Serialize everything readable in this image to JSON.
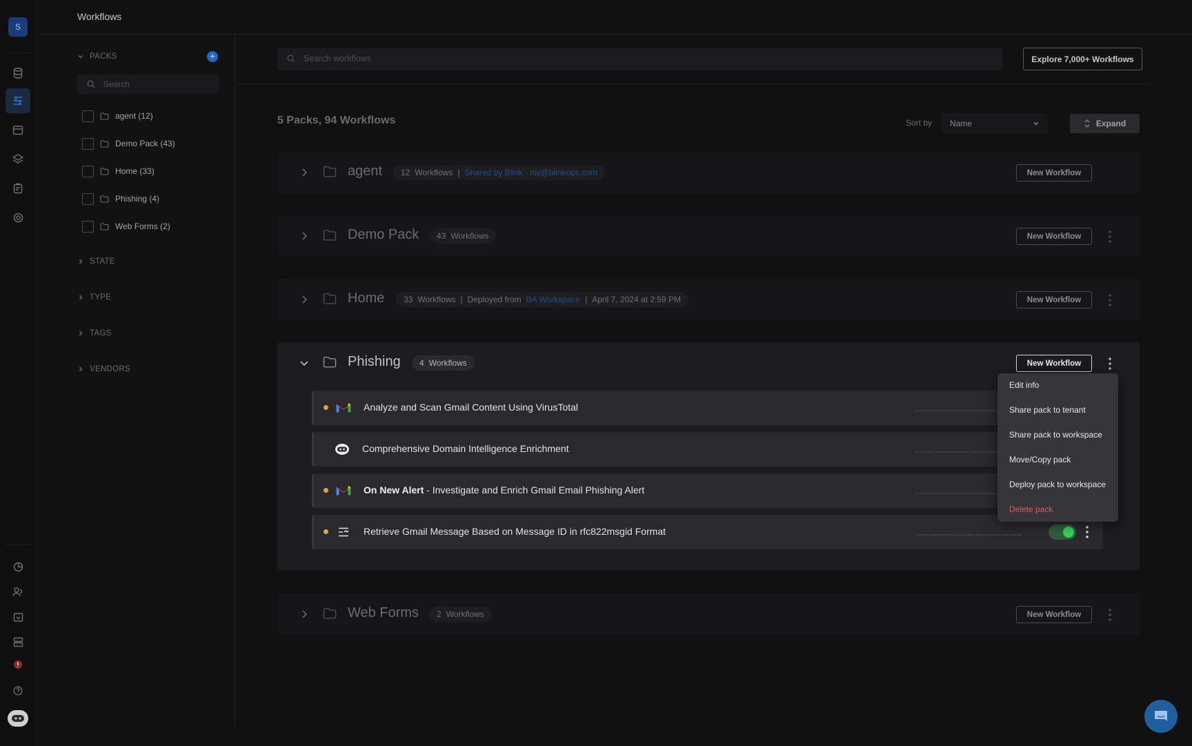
{
  "app": {
    "avatar_letter": "S",
    "page_title": "Workflows"
  },
  "rail": {
    "top_icons": [
      "database-icon",
      "workflows-icon",
      "calendar-icon",
      "layers-icon",
      "cases-icon",
      "target-icon"
    ],
    "bottom_icons": [
      "pie-chart-icon",
      "users-icon",
      "inbox-icon",
      "server-icon",
      "alert-badge-icon",
      "help-icon",
      "assistant-icon"
    ],
    "active": "workflows-icon"
  },
  "filters": {
    "packs_heading": "PACKS",
    "search_placeholder": "Search",
    "packs": [
      {
        "label": "agent (12)"
      },
      {
        "label": "Demo Pack (43)"
      },
      {
        "label": "Home (33)"
      },
      {
        "label": "Phishing (4)"
      },
      {
        "label": "Web Forms (2)"
      }
    ],
    "sections": [
      "STATE",
      "TYPE",
      "TAGS",
      "VENDORS"
    ]
  },
  "toolbar": {
    "search_placeholder": "Search workflows",
    "explore_label": "Explore 7,000+ Workflows",
    "summary": "5 Packs, 94 Workflows",
    "sort_label": "Sort by",
    "sort_value": "Name",
    "expand_label": "Expand"
  },
  "packs": [
    {
      "name": "agent",
      "count": "12",
      "count_label": "Workflows",
      "sep": "|",
      "shared": "Shared by Blink - niv@blinkops.com",
      "new_label": "New Workflow"
    },
    {
      "name": "Demo Pack",
      "count": "43",
      "count_label": "Workflows",
      "new_label": "New Workflow"
    },
    {
      "name": "Home",
      "count": "33",
      "count_label": "Workflows",
      "sep": "|",
      "deployed_label": "Deployed from",
      "deployed_link": "BA Workspace",
      "deployed_date": "April 7, 2024 at 2:59 PM",
      "new_label": "New Workflow"
    },
    {
      "name": "Phishing",
      "count": "4",
      "count_label": "Workflows",
      "new_label": "New Workflow"
    },
    {
      "name": "Web Forms",
      "count": "2",
      "count_label": "Workflows",
      "new_label": "New Workflow"
    }
  ],
  "phishing_workflows": [
    {
      "icon": "gmail-icon",
      "status_color": "#e1a43a",
      "label": "Analyze and Scan Gmail Content Using VirusTotal"
    },
    {
      "icon": "blink-icon",
      "status_color": null,
      "label": "Comprehensive Domain Intelligence Enrichment"
    },
    {
      "icon": "gmail-icon",
      "status_color": "#e1a43a",
      "bold": "On New Alert",
      "label": " - Investigate and Enrich Gmail Email Phishing Alert"
    },
    {
      "icon": "webhook-icon",
      "status_color": "#e1a43a",
      "label": "Retrieve Gmail Message Based on Message ID in rfc822msgid Format",
      "enabled": true
    }
  ],
  "context_menu": {
    "items": [
      "Edit info",
      "Share pack to tenant",
      "Share pack to workspace",
      "Move/Copy pack",
      "Deploy pack to workspace",
      "Delete pack"
    ]
  },
  "colors": {
    "accent": "#1c6bc0",
    "danger": "#e05a62",
    "toggle_on": "#36d35b",
    "status_dot": "#e1a43a"
  }
}
